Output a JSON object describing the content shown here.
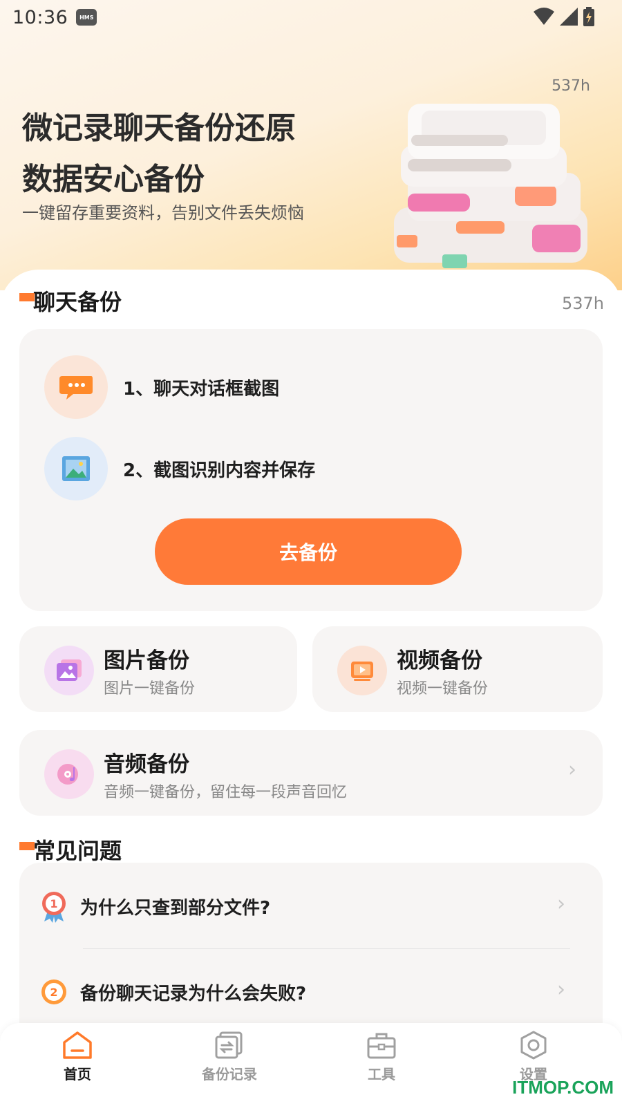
{
  "status_bar": {
    "time": "10:36",
    "badge": "HMS"
  },
  "hero": {
    "usage": "537h",
    "title": "微记录聊天备份还原",
    "title2": "数据安心备份",
    "subtitle": "一键留存重要资料，告别文件丢失烦恼"
  },
  "chat_backup": {
    "title": "聊天备份",
    "usage": "537h",
    "steps": [
      {
        "label": "1、聊天对话框截图",
        "icon": "chat-bubble-icon"
      },
      {
        "label": "2、截图识别内容并保存",
        "icon": "image-scan-icon"
      }
    ],
    "button": "去备份"
  },
  "tiles": {
    "image": {
      "title": "图片备份",
      "subtitle": "图片一键备份",
      "icon": "image-icon"
    },
    "video": {
      "title": "视频备份",
      "subtitle": "视频一键备份",
      "icon": "video-icon"
    },
    "audio": {
      "title": "音频备份",
      "subtitle": "音频一键备份，留住每一段声音回忆",
      "icon": "music-disc-icon"
    }
  },
  "faq": {
    "title": "常见问题",
    "items": [
      {
        "badge": "1",
        "question": "为什么只查到部分文件?"
      },
      {
        "badge": "2",
        "question": "备份聊天记录为什么会失败?"
      }
    ]
  },
  "tabbar": {
    "items": [
      {
        "label": "首页",
        "icon": "home-icon",
        "active": true
      },
      {
        "label": "备份记录",
        "icon": "backup-record-icon",
        "active": false
      },
      {
        "label": "工具",
        "icon": "toolbox-icon",
        "active": false
      },
      {
        "label": "设置",
        "icon": "settings-icon",
        "active": false
      }
    ]
  },
  "watermark": "ITMOP.COM",
  "colors": {
    "accent": "#ff7a38",
    "card_bg": "#f7f5f4",
    "hero_gradient_end": "#fdd08a"
  }
}
